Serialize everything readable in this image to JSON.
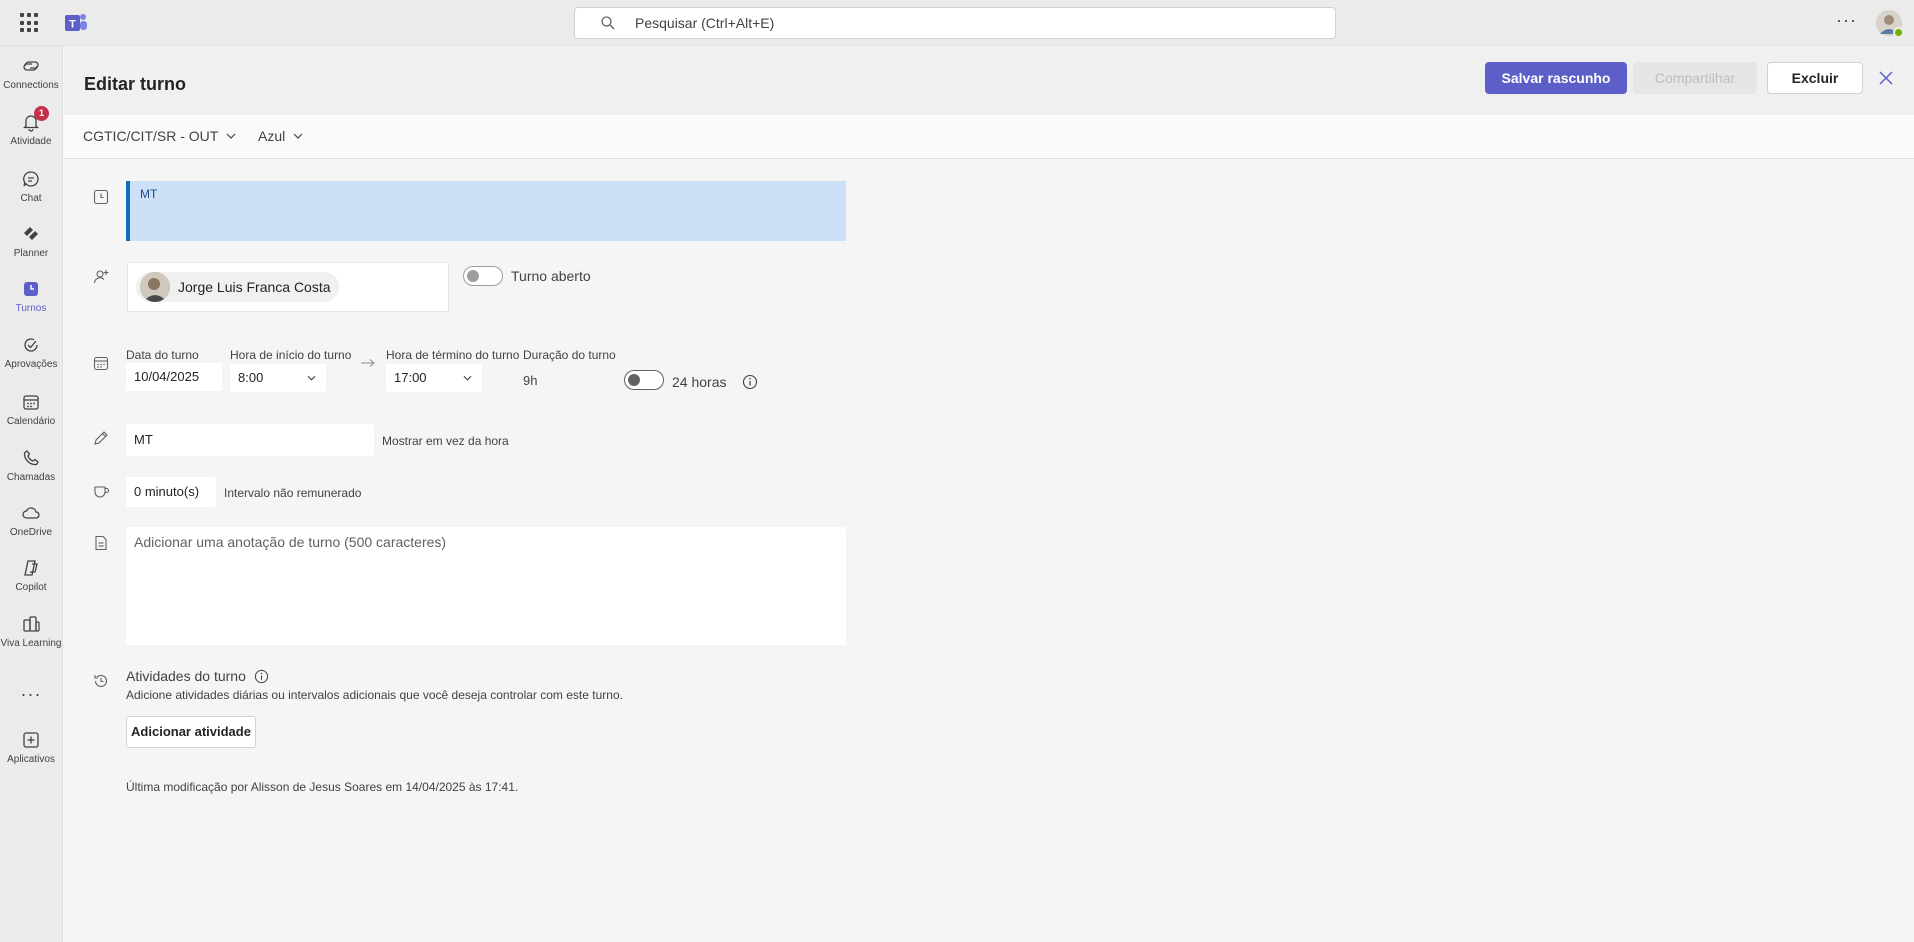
{
  "search": {
    "placeholder": "Pesquisar (Ctrl+Alt+E)"
  },
  "rail": {
    "items": [
      {
        "label": "Connections",
        "icon": "connections-icon"
      },
      {
        "label": "Atividade",
        "icon": "bell-icon",
        "badge": "1"
      },
      {
        "label": "Chat",
        "icon": "chat-icon"
      },
      {
        "label": "Planner",
        "icon": "planner-icon"
      },
      {
        "label": "Turnos",
        "icon": "shifts-icon",
        "active": true
      },
      {
        "label": "Aprovações",
        "icon": "approvals-icon"
      },
      {
        "label": "Calendário",
        "icon": "calendar-icon"
      },
      {
        "label": "Chamadas",
        "icon": "phone-icon"
      },
      {
        "label": "OneDrive",
        "icon": "cloud-icon"
      },
      {
        "label": "Copilot",
        "icon": "copilot-icon"
      },
      {
        "label": "Viva Learning",
        "icon": "viva-learning-icon"
      },
      {
        "label": "Aplicativos",
        "icon": "add-apps-icon"
      }
    ],
    "more": "···"
  },
  "header": {
    "title": "Editar turno",
    "save_draft": "Salvar rascunho",
    "share": "Compartilhar",
    "delete": "Excluir"
  },
  "filters": {
    "group": "CGTIC/CIT/SR - OUT",
    "color": "Azul"
  },
  "shift": {
    "label": "MT",
    "member": "Jorge Luis Franca Costa",
    "open_shift_label": "Turno aberto",
    "date_label": "Data do turno",
    "date": "10/04/2025",
    "start_label": "Hora de início do turno",
    "start": "8:00",
    "end_label": "Hora de término do turno",
    "end": "17:00",
    "duration_label": "Duração do turno",
    "duration": "9h",
    "hours24_label": "24 horas",
    "display_value": "MT",
    "display_hint": "Mostrar em vez da hora",
    "break_value": "0 minuto(s)",
    "break_hint": "Intervalo não remunerado",
    "notes_placeholder": "Adicionar uma anotação de turno (500 caracteres)"
  },
  "activities": {
    "title": "Atividades do turno",
    "description": "Adicione atividades diárias ou intervalos adicionais que você deseja controlar com este turno.",
    "add_button": "Adicionar atividade"
  },
  "last_modified": "Última modificação por Alisson de Jesus Soares em 14/04/2025 às 17:41.",
  "colors": {
    "accent": "#5b5fc7",
    "shift_fill": "#cce1f7",
    "shift_border": "#0f6cbd",
    "badge": "#c4314b",
    "presence": "#6bb700"
  }
}
